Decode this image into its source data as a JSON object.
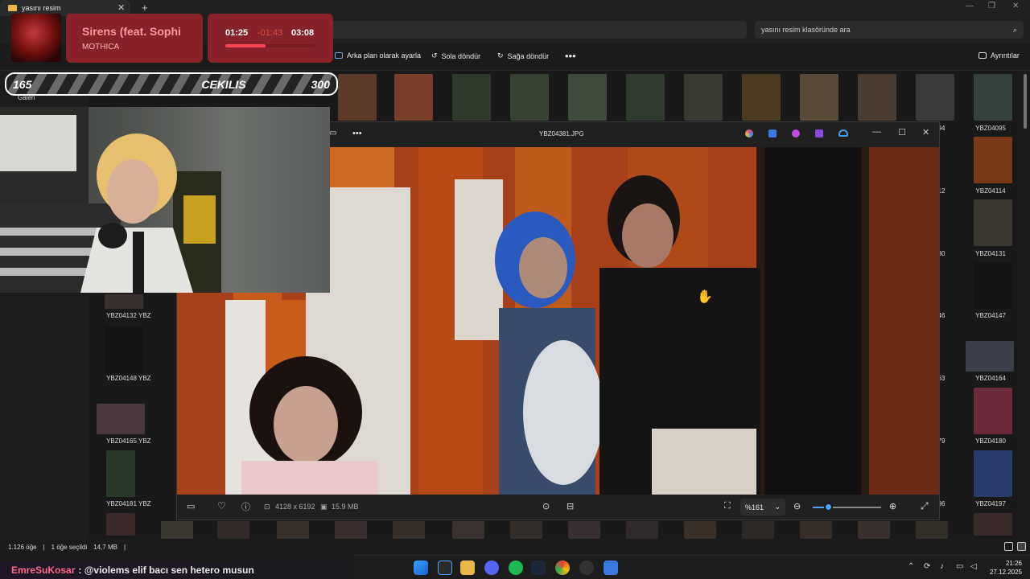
{
  "explorer": {
    "tab_title": "yasını resim",
    "new_tab": "+",
    "search_placeholder": "yasını resim klasöründe ara",
    "commands": [
      "Arka plan olarak ayarla",
      "Sola döndür",
      "Sağa döndür"
    ],
    "more": "•••",
    "details": "Ayrıntılar",
    "sidebar_galeri": "Galeri",
    "status_count": "1.126 öğe",
    "status_selected": "1 öğe seçildi",
    "status_size": "14,7 MB",
    "thumb_labels_left": [
      "YBZ04132",
      "YBZ04148",
      "YBZ04165",
      "YBZ04181"
    ],
    "thumb_labels_right": [
      "YBZ04095",
      "YBZ04114",
      "YBZ04131",
      "YBZ04147",
      "YBZ04164",
      "YBZ04180",
      "YBZ04197"
    ],
    "thumb_labels_partial_right": [
      "94",
      "12",
      "30",
      "46",
      "63",
      "79",
      "96"
    ],
    "thumb_labels_partial_left": [
      "YBZ",
      "YBZ",
      "YBZ",
      "YBZ"
    ]
  },
  "now_playing": {
    "title": "Sirens (feat. Sophi",
    "artist": "MOTHICA",
    "current": "01:25",
    "middle": "-01:43",
    "total": "03:08",
    "progress": 0.45
  },
  "giveaway": {
    "left": "165",
    "label": "CEKILIS",
    "right": "300"
  },
  "viewer": {
    "filename": "YBZ04381.JPG",
    "more": "•••",
    "dimensions": "4128 x 6192",
    "filesize": "15.9 MB",
    "zoom": "%161",
    "zoom_level": 0.22
  },
  "chat": {
    "user": "EmreSuKosar",
    "message": ": @violems elif bacı sen hetero musun"
  },
  "clock": {
    "time": "21:26",
    "date": "27.12.2025"
  },
  "colors": {
    "accent": "#4aa3ff",
    "overlay_red": "#96222c",
    "chat_user": "#ff6b8a"
  }
}
